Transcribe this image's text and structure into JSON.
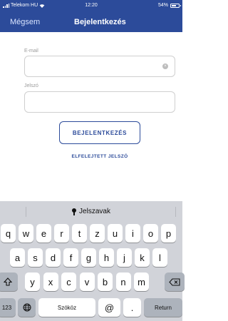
{
  "status_bar": {
    "carrier": "Telekom HU",
    "time": "12:20",
    "battery": "54%"
  },
  "nav": {
    "cancel_label": "Mégsem",
    "title": "Bejelentkezés"
  },
  "form": {
    "email_label": "E-mail",
    "email_value": "",
    "password_label": "Jelszó",
    "password_value": "",
    "login_button": "BEJELENTKEZÉS",
    "forgot_password": "ELFELEJTETT JELSZÓ"
  },
  "keyboard": {
    "suggestion": "Jelszavak",
    "row1": [
      "q",
      "w",
      "e",
      "r",
      "t",
      "z",
      "u",
      "i",
      "o",
      "p"
    ],
    "row2": [
      "a",
      "s",
      "d",
      "f",
      "g",
      "h",
      "j",
      "k",
      "l"
    ],
    "row3": [
      "y",
      "x",
      "c",
      "v",
      "b",
      "n",
      "m"
    ],
    "numbers_key": "123",
    "space_key": "Szóköz",
    "at_key": "@",
    "dot_key": ".",
    "return_key": "Return"
  }
}
